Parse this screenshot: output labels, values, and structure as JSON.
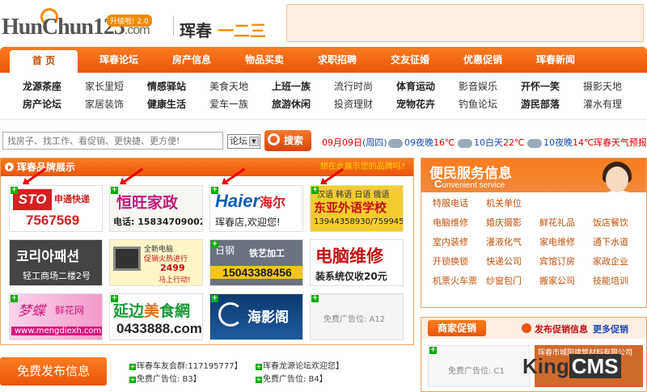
{
  "header": {
    "logo_text": "HunChun123",
    "logo_domain": ".com",
    "logo_upgrade": "升级啦! 2.0",
    "logo_cn_main": "珲春",
    "logo_cn_num": "一二三"
  },
  "nav": [
    "首 页",
    "珲春论坛",
    "房产信息",
    "物品买卖",
    "求职招聘",
    "交友征婚",
    "优惠促销",
    "珲春新闻"
  ],
  "subnav": {
    "row1": [
      "龙源茶座",
      "家长里短",
      "情感驿站",
      "美食天地",
      "上班一族",
      "流行时尚",
      "体育运动",
      "影音娱乐",
      "开怀一笑",
      "摄影天地"
    ],
    "row2": [
      "房产论坛",
      "家居装饰",
      "健康生活",
      "爱车一族",
      "旅游休闲",
      "投资理财",
      "宠物花卉",
      "钓鱼论坛",
      "游民部落",
      "灌水有理"
    ]
  },
  "search": {
    "placeholder": "找房子、找工作、看促销、更快捷、更方便!",
    "select_value": "论坛",
    "button_label": "搜索"
  },
  "weather": {
    "date": "09月09日",
    "weekday": "(周四)",
    "d1": "09夜晚",
    "t1": "16℃",
    "d2": "10白天",
    "t2": "22℃",
    "d3": "10夜晚",
    "t3": "14℃",
    "forecast": "珲春天气预报"
  },
  "brand": {
    "title": "珲春品牌展示",
    "link": "想在此展示您的品牌吗?",
    "ads": {
      "sto_logo": "STO",
      "sto_name": "申通快递",
      "sto_phone": "7567569",
      "hw_name": "恒旺家政",
      "hw_phone": "电话: 15834709002",
      "haier_logo": "Haier",
      "haier_cn": "海尔",
      "haier_slogan": "珲春店,欢迎您!",
      "lang_top": "汉语 韩语 日语 俄语",
      "lang_name": "东亚外语学校",
      "lang_phone": "13944358930/7599455",
      "kor_text": "코리아패션",
      "kor_addr": "轻工商场二楼2号",
      "pc_t1": "全新电脑",
      "pc_t2": "促销火热进行",
      "pc_price": "2499",
      "pc_go": "马上行动!",
      "steel_brand": "日钢",
      "steel_name": "铁艺加工",
      "steel_phone": "15043388456",
      "repair_name": "电脑维修",
      "repair_price": "装系统仅收20元",
      "flower_name": "梦蝶",
      "flower_sub": "鲜花网",
      "flower_url": "www.mengdiexh.com",
      "food_name_a": "延边",
      "food_name_b": "美",
      "food_name_c": "食網",
      "food_phone": "0433888.com",
      "photo_name": "海影阁",
      "free_text": "免费广告位: A12"
    }
  },
  "bottom": {
    "free_button": "免费发布信息",
    "info1": "珲春车友会群:117195777】",
    "info2": "免费广告位: B3】",
    "info3": "珲春龙源论坛欢迎您】",
    "info4": "免费广告位: B4】"
  },
  "service": {
    "title": "便民服务信息",
    "subtitle_big": "C",
    "subtitle": "onvenient service",
    "items": [
      "特服电话",
      "机关单位",
      "",
      "",
      "电脑维修",
      "婚庆摄影",
      "鲜花礼品",
      "饭店餐饮",
      "室内装修",
      "灌液化气",
      "家电维修",
      "通下水道",
      "开锁换锁",
      "快递公司",
      "宾馆订房",
      "家政企业",
      "机票火车票",
      "纱窗包门",
      "搬家公司",
      "技能培训"
    ]
  },
  "promo": {
    "tag": "商家促销",
    "info": "发布促销信息",
    "more": "更多促销",
    "free": "免费广告位: C1",
    "ad2_text": "珲春市城阳建筑材料有限公司"
  },
  "watermark": {
    "brand_a": "King",
    "brand_b": "CMS"
  }
}
